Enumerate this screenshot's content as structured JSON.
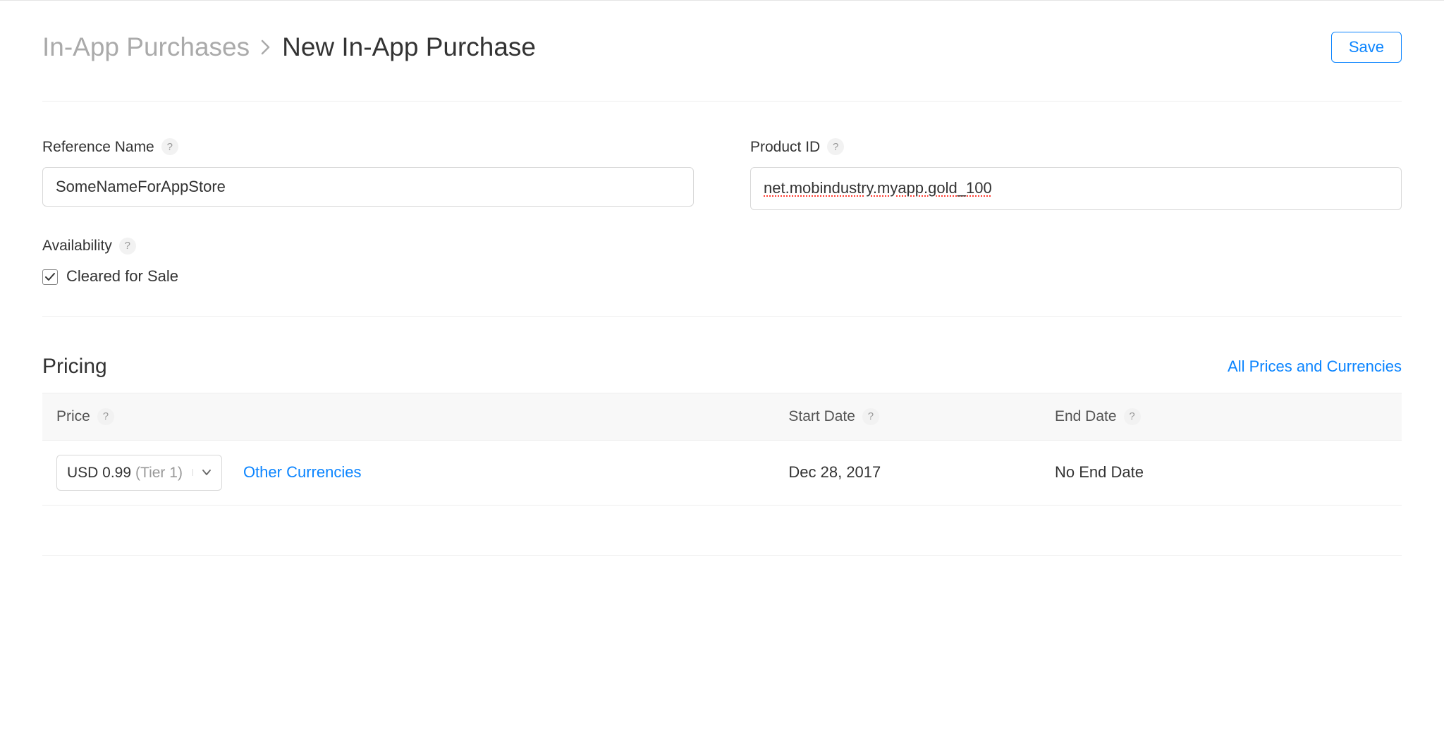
{
  "breadcrumb": {
    "parent": "In-App Purchases",
    "current": "New In-App Purchase"
  },
  "actions": {
    "save": "Save"
  },
  "fields": {
    "referenceName": {
      "label": "Reference Name",
      "value": "SomeNameForAppStore"
    },
    "productId": {
      "label": "Product ID",
      "value": "net.mobindustry.myapp.gold_100"
    },
    "availability": {
      "label": "Availability",
      "clearedForSale": {
        "label": "Cleared for Sale",
        "checked": true
      }
    }
  },
  "pricing": {
    "title": "Pricing",
    "allPricesLink": "All Prices and Currencies",
    "columns": {
      "price": "Price",
      "startDate": "Start Date",
      "endDate": "End Date"
    },
    "row": {
      "priceValue": "USD 0.99",
      "priceTier": "(Tier 1)",
      "otherCurrenciesLink": "Other Currencies",
      "startDate": "Dec 28, 2017",
      "endDate": "No End Date"
    }
  }
}
